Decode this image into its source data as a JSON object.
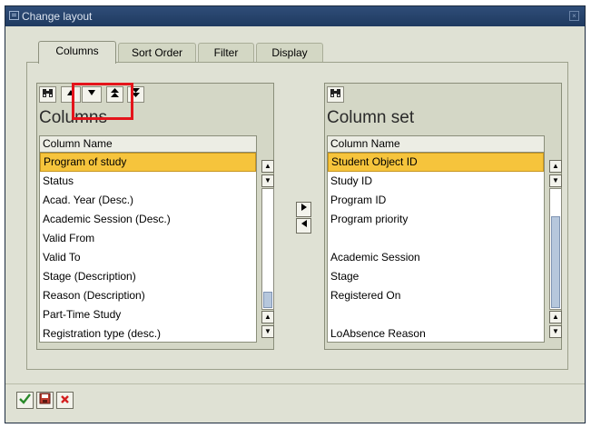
{
  "window": {
    "title": "Change layout"
  },
  "tabs": [
    {
      "label": "Columns",
      "active": true
    },
    {
      "label": "Sort Order",
      "active": false
    },
    {
      "label": "Filter",
      "active": false
    },
    {
      "label": "Display",
      "active": false
    }
  ],
  "left_box": {
    "title": "Columns",
    "column_header": "Column Name",
    "rows": [
      "Program of study",
      "Status",
      "Acad. Year (Desc.)",
      "Academic Session (Desc.)",
      "Valid From",
      "Valid To",
      "Stage (Description)",
      "Reason (Description)",
      "Part-Time Study",
      "Registration type (desc.)"
    ],
    "selected_index": 0,
    "toolbar_icons": [
      "find-icon",
      "move-up-icon",
      "move-down-icon",
      "move-top-icon",
      "move-bottom-icon"
    ]
  },
  "right_box": {
    "title": "Column set",
    "column_header": "Column Name",
    "rows": [
      "Student Object ID",
      "Study ID",
      "Program ID",
      "Program priority",
      "",
      "Academic Session",
      "Stage",
      "Registered On",
      "",
      "LoAbsence Reason"
    ],
    "selected_index": 0,
    "toolbar_icons": [
      "find-icon"
    ]
  },
  "footer_icons": [
    "confirm-check-icon",
    "save-layout-icon",
    "cancel-x-icon"
  ],
  "colors": {
    "title_bar": "#1f3a60",
    "background": "#dfe1d4",
    "selection": "#f6c43c",
    "highlight_box": "#e4141b",
    "cancel_red": "#d42020",
    "confirm_green": "#2a8a2a"
  }
}
